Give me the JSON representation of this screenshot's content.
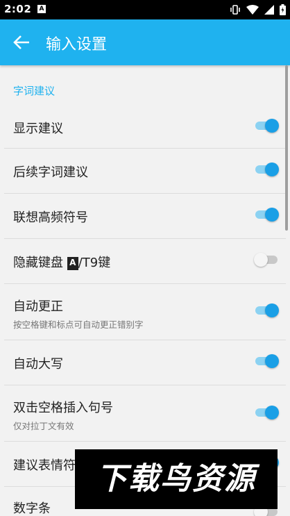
{
  "status_bar": {
    "time": "2:02",
    "notification_icon": "A",
    "icons": [
      "vibrate-icon",
      "wifi-icon",
      "signal-icon",
      "battery-icon"
    ]
  },
  "app_bar": {
    "title": "输入设置",
    "back_icon": "arrow-back-icon"
  },
  "colors": {
    "accent": "#1fb2ef",
    "toggle_on": "#1a9fe6"
  },
  "section": {
    "title": "字词建议"
  },
  "settings": [
    {
      "label": "显示建议",
      "on": true
    },
    {
      "label": "后续字词建议",
      "on": true
    },
    {
      "label": "联想高频符号",
      "on": true
    },
    {
      "label_prefix": "隐藏键盘 ",
      "label_icon": "A",
      "label_suffix": "/T9键",
      "on": false
    },
    {
      "label": "自动更正",
      "subtitle": "按空格键和标点可自动更正错别字",
      "on": true
    },
    {
      "label": "自动大写",
      "on": true
    },
    {
      "label": "双击空格插入句号",
      "subtitle": "仅对拉丁文有效",
      "on": true
    },
    {
      "label": "建议表情符",
      "on": true
    },
    {
      "label": "数字条",
      "on": false
    }
  ],
  "watermark": "下载鸟资源"
}
